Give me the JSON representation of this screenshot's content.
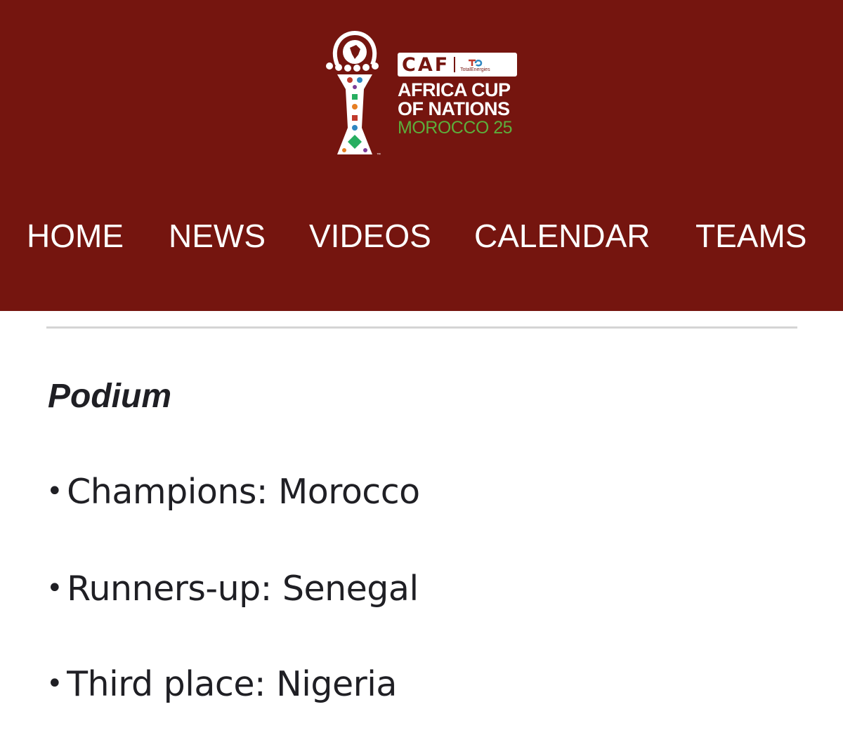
{
  "header": {
    "background": "#75150f",
    "logo": {
      "caf": "CAF",
      "sponsor_small": "TotalEnergies",
      "line1": "AFRICA CUP",
      "line2": "OF NATIONS",
      "line3": "MOROCCO 25",
      "accent_green": "#5cae3c"
    }
  },
  "nav": {
    "items": [
      {
        "label": "HOME"
      },
      {
        "label": "NEWS"
      },
      {
        "label": "VIDEOS"
      },
      {
        "label": "CALENDAR"
      },
      {
        "label": "TEAMS"
      }
    ]
  },
  "content": {
    "section_title": "Podium",
    "items": [
      {
        "bullet": "•",
        "label": "Champions:",
        "value": "Morocco"
      },
      {
        "bullet": "•",
        "label": "Runners-up:",
        "value": "Senegal"
      },
      {
        "bullet": "•",
        "label": "Third place:",
        "value": "Nigeria"
      }
    ]
  }
}
